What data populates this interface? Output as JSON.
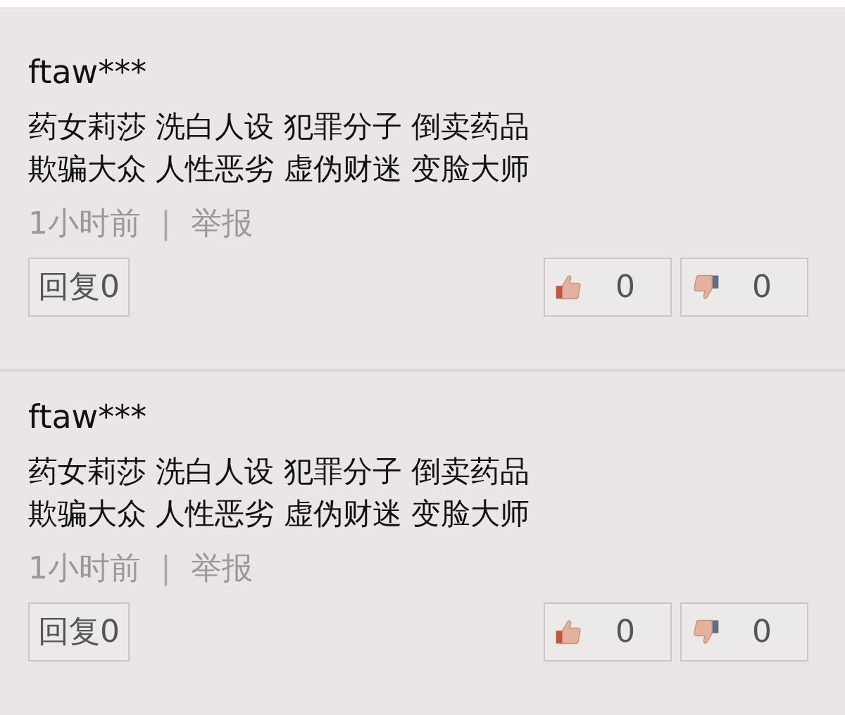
{
  "comments": [
    {
      "user": "ftaw***",
      "lines": [
        "药女莉莎 洗白人设 犯罪分子 倒卖药品",
        "欺骗大众 人性恶劣 虚伪财迷 变脸大师"
      ],
      "time": "1小时前",
      "separator": "|",
      "report": "举报",
      "reply": "回复0",
      "likes": "0",
      "dislikes": "0"
    },
    {
      "user": "ftaw***",
      "lines": [
        "药女莉莎 洗白人设 犯罪分子 倒卖药品",
        "欺骗大众 人性恶劣 虚伪财迷 变脸大师"
      ],
      "time": "1小时前",
      "separator": "|",
      "report": "举报",
      "reply": "回复0",
      "likes": "0",
      "dislikes": "0"
    }
  ]
}
